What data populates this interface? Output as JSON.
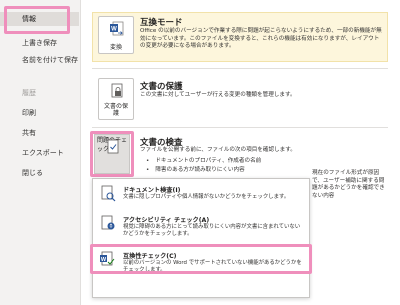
{
  "nav": {
    "items": [
      {
        "label": "情報"
      },
      {
        "label": "上書き保存"
      },
      {
        "label": "名前を付けて保存"
      },
      {
        "label": "履歴"
      },
      {
        "label": "印刷"
      },
      {
        "label": "共有"
      },
      {
        "label": "エクスポート"
      },
      {
        "label": "閉じる"
      }
    ]
  },
  "compat": {
    "button_label": "変換",
    "title": "互換モード",
    "description": "Office の以前のバージョンで作業する際に問題が起こらないようにするため、一部の新機能が無効になっています。このファイルを変換すると、これらの機能は有効になりますが、レイアウトの変更が必要になる場合があります。"
  },
  "protect": {
    "button_label": "文書の保護",
    "title": "文書の保護",
    "description": "この文書に対してユーザーが行える変更の種類を管理します。"
  },
  "inspect": {
    "button_label": "問題のチェック",
    "title": "文書の検査",
    "description": "ファイルを公開する前に、ファイルの次の項目を確認します。",
    "bullets": [
      "ドキュメントのプロパティ、作成者の名前",
      "障害のある方が読み取りにくい内容"
    ],
    "extra": "現在のファイル形式が原因で、ユーザー補助に関する問題があるかどうかを確認できない内容"
  },
  "menu": {
    "items": [
      {
        "title": "ドキュメント検査(I)",
        "description": "文書に隠しプロパティや個人情報がないかどうかをチェックします。"
      },
      {
        "title": "アクセシビリティ チェック(A)",
        "description": "視覚に障碍のある方にとって読み取りにくい内容が文書に含まれていないかどうかをチェックします。"
      },
      {
        "title": "互換性チェック(C)",
        "description": "以前のバージョンの Word でサポートされていない機能があるかどうかをチェックします。"
      }
    ]
  },
  "colors": {
    "highlight": "#ef8fbc",
    "warning_bg": "#fdf6dc",
    "word_blue": "#2b579a"
  },
  "icons": {
    "convert": "word-doc-convert-icon",
    "protect": "lock-document-icon",
    "inspect": "document-check-icon",
    "doc_inspect": "document-search-icon",
    "accessibility": "accessibility-icon",
    "compat": "compatibility-check-icon"
  }
}
